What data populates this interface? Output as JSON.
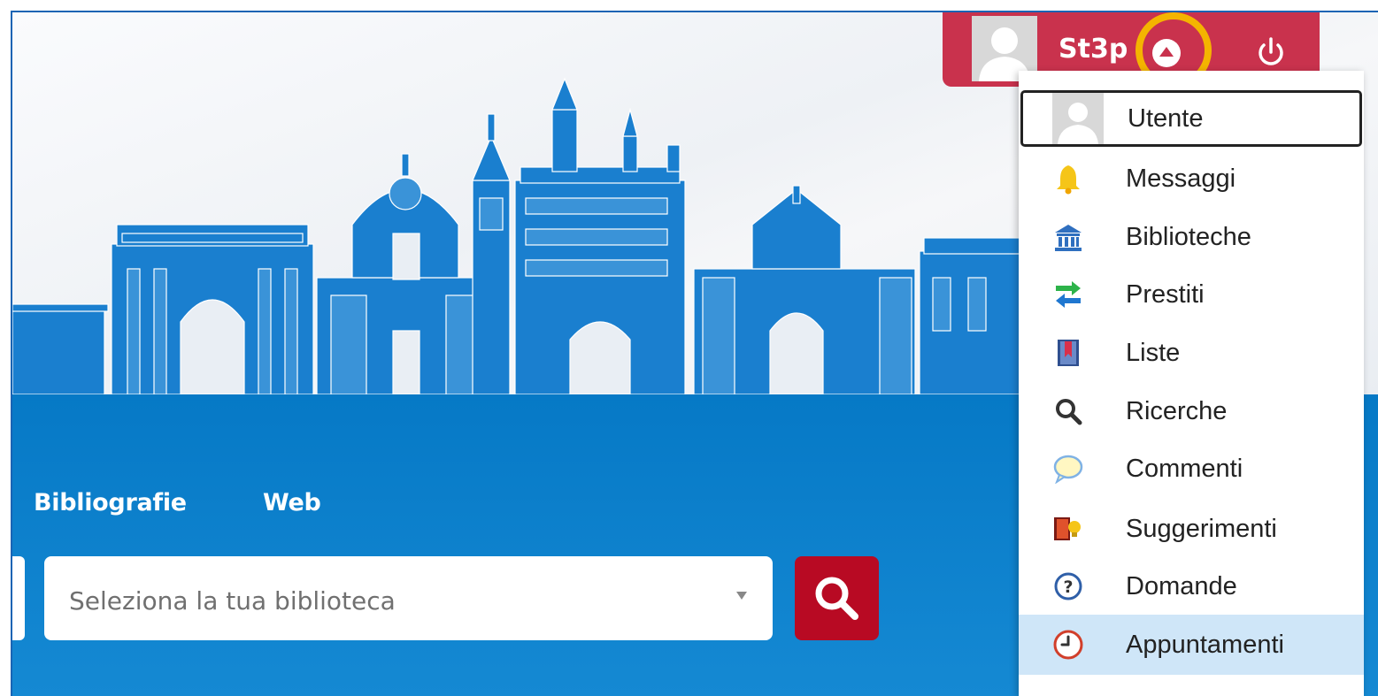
{
  "user": {
    "name": "St3p"
  },
  "nav": {
    "tabs": [
      {
        "label": "Bibliografie"
      },
      {
        "label": "Web"
      }
    ]
  },
  "search": {
    "library_placeholder": "Seleziona la tua biblioteca"
  },
  "menu": {
    "items": [
      {
        "label": "Utente",
        "icon": "user-icon"
      },
      {
        "label": "Messaggi",
        "icon": "bell-icon"
      },
      {
        "label": "Biblioteche",
        "icon": "library-icon"
      },
      {
        "label": "Prestiti",
        "icon": "loan-arrows-icon"
      },
      {
        "label": "Liste",
        "icon": "list-bookmark-icon"
      },
      {
        "label": "Ricerche",
        "icon": "magnifier-icon"
      },
      {
        "label": "Commenti",
        "icon": "comment-bubble-icon"
      },
      {
        "label": "Suggerimenti",
        "icon": "suggestion-icon"
      },
      {
        "label": "Domande",
        "icon": "question-icon"
      },
      {
        "label": "Appuntamenti",
        "icon": "clock-icon"
      }
    ],
    "focused_index": 0,
    "active_index": 9
  },
  "colors": {
    "brand_red": "#c9324d",
    "search_red": "#b80a23",
    "band_blue": "#0679c6",
    "skyline_blue": "#1a7fcf",
    "highlight_ring": "#f4b400",
    "active_row": "#cfe6f8"
  }
}
